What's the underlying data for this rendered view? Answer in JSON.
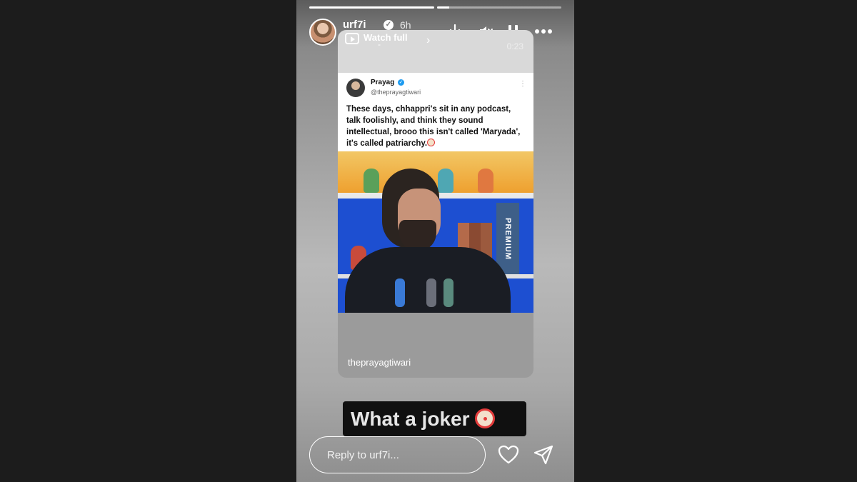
{
  "story": {
    "username": "urf7i",
    "time": "6h",
    "progress": [
      1.0,
      0.1
    ]
  },
  "header_icons": [
    "download-icon",
    "mute-icon",
    "pause-icon",
    "more-icon"
  ],
  "reel": {
    "watch_full": "Watch full",
    "dash": "-",
    "duration": "0:23",
    "footer_handle": "theprayagtiwari"
  },
  "tweet": {
    "name": "Prayag",
    "handle": "@theprayagtiwari",
    "text": "These days, chhappri's sit in any podcast, talk foolishly, and think they sound intellectual, brooo this isn't called 'Maryada', it's called patriarchy."
  },
  "video": {
    "shelf_label": "PREMIUM"
  },
  "caption": {
    "text": "What a joker"
  },
  "reply": {
    "placeholder": "Reply to urf7i..."
  },
  "colors": {
    "page_bg": "#1c1c1c",
    "verified": "#1d9bf0",
    "caption_bg": "#101010"
  }
}
